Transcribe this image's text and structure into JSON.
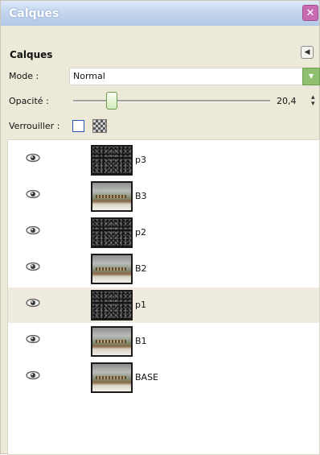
{
  "window": {
    "title": "Calques"
  },
  "dock": {
    "header": "Calques"
  },
  "mode": {
    "label": "Mode :",
    "value": "Normal"
  },
  "opacity": {
    "label": "Opacité :",
    "value": "20,4",
    "level_percent": 20.4
  },
  "lock": {
    "label": "Verrouiller :"
  },
  "layers": [
    {
      "name": "p3",
      "thumbnail": "noise",
      "visible": true,
      "selected": false
    },
    {
      "name": "B3",
      "thumbnail": "photo",
      "visible": true,
      "selected": false
    },
    {
      "name": "p2",
      "thumbnail": "noise",
      "visible": true,
      "selected": false
    },
    {
      "name": "B2",
      "thumbnail": "photo",
      "visible": true,
      "selected": false
    },
    {
      "name": "p1",
      "thumbnail": "noise",
      "visible": true,
      "selected": true
    },
    {
      "name": "B1",
      "thumbnail": "photo",
      "visible": true,
      "selected": false
    },
    {
      "name": "BASE",
      "thumbnail": "photo",
      "visible": true,
      "selected": false
    }
  ],
  "icons": {
    "close": "close-icon",
    "dock_menu": "triangle-left-icon",
    "mode_dropdown": "chevron-down-icon",
    "eye": "eye-icon",
    "lock_pixels": "checkbox-icon",
    "lock_alpha": "checkerboard-icon"
  },
  "colors": {
    "titlebar": "#c4d6ef",
    "close_button": "#c86bb0",
    "panel_bg": "#ece9d8",
    "selected_row": "#efebdf",
    "dropdown_button": "#8fbf6e"
  }
}
